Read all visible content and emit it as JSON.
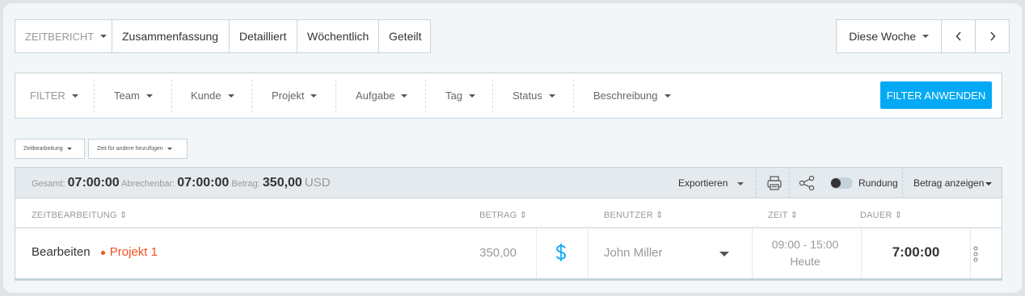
{
  "report_tabs": {
    "type_label": "ZEITBERICHT",
    "tabs": [
      "Zusammenfassung",
      "Detailliert",
      "Wöchentlich",
      "Geteilt"
    ]
  },
  "date_range": {
    "label": "Diese Woche",
    "prev_icon": "chevron-left-icon",
    "next_icon": "chevron-right-icon"
  },
  "filters": {
    "label": "FILTER",
    "items": [
      "Team",
      "Kunde",
      "Projekt",
      "Aufgabe",
      "Tag",
      "Status",
      "Beschreibung"
    ],
    "apply_label": "FILTER ANWENDEN"
  },
  "actions": {
    "edit_time": "Zeitbearbeitung",
    "add_time_for_others": "Zeit für andere hinzufügen"
  },
  "summary": {
    "total_label": "Gesamt:",
    "total_value": "07:00:00",
    "billable_label": "Abrechenbar:",
    "billable_value": "07:00:00",
    "amount_label": "Betrag:",
    "amount_value": "350,00",
    "currency": "USD",
    "export_label": "Exportieren",
    "rounding_label": "Rundung",
    "show_amount_label": "Betrag anzeigen"
  },
  "table": {
    "headers": {
      "entry": "ZEITBEARBEITUNG",
      "amount": "BETRAG",
      "user": "BENUTZER",
      "time": "ZEIT",
      "duration": "DAUER"
    },
    "rows": [
      {
        "description": "Bearbeiten",
        "project": "Projekt 1",
        "project_color": "#f4511e",
        "amount": "350,00",
        "billable_icon": "dollar-icon",
        "user": "John Miller",
        "time_range": "09:00 - 15:00",
        "day": "Heute",
        "duration": "7:00:00"
      }
    ]
  },
  "colors": {
    "accent": "#03a9f4",
    "project": "#f4511e"
  }
}
